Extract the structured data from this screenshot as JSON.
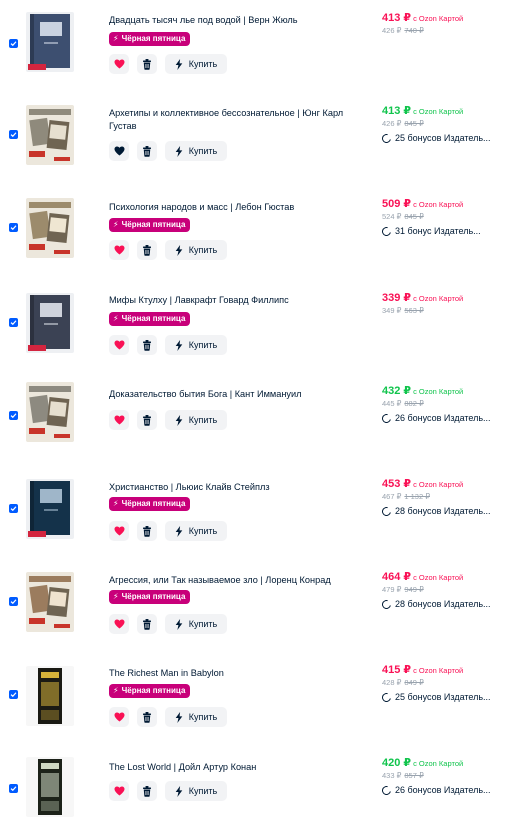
{
  "items": [
    {
      "title": "Двадцать тысяч лье под водой | Верн Жюль",
      "badge": "Чёрная пятница",
      "buy": "Купить",
      "price": "413 ₽",
      "price_color": "pink",
      "card": "с Ozon Картой",
      "base": "426 ₽",
      "old": "740 ₽",
      "bonus": "",
      "fav": true,
      "cover": {
        "bg": "#3d4f70",
        "fg": "#c9d2e0",
        "kind": "navy"
      }
    },
    {
      "title": "Архетипы и коллективное бессознательное | Юнг Карл Густав",
      "badge": "",
      "buy": "Купить",
      "price": "413 ₽",
      "price_color": "green",
      "card": "с Ozon Картой",
      "base": "426 ₽",
      "old": "845 ₽",
      "bonus": "25 бонусов Издатель...",
      "fav": false,
      "cover": {
        "bg": "#8f8a7c",
        "fg": "#e6dfcf",
        "kind": "collage"
      }
    },
    {
      "title": "Психология народов и масс | Лебон Гюстав",
      "badge": "Чёрная пятница",
      "buy": "Купить",
      "price": "509 ₽",
      "price_color": "pink",
      "card": "с Ozon Картой",
      "base": "524 ₽",
      "old": "845 ₽",
      "bonus": "31 бонус Издатель...",
      "fav": true,
      "cover": {
        "bg": "#9c8b6c",
        "fg": "#efe6d2",
        "kind": "collage"
      }
    },
    {
      "title": "Мифы Ктулху | Лавкрафт Говард Филлипс",
      "badge": "Чёрная пятница",
      "buy": "Купить",
      "price": "339 ₽",
      "price_color": "pink",
      "card": "с Ozon Картой",
      "base": "349 ₽",
      "old": "563 ₽",
      "bonus": "",
      "fav": true,
      "cover": {
        "bg": "#3b4254",
        "fg": "#cfd3dc",
        "kind": "navy"
      }
    },
    {
      "title": "Доказательство бытия Бога | Кант Иммануил",
      "badge": "",
      "buy": "Купить",
      "price": "432 ₽",
      "price_color": "green",
      "card": "с Ozon Картой",
      "base": "445 ₽",
      "old": "882 ₽",
      "bonus": "26 бонусов Издатель...",
      "fav": true,
      "cover": {
        "bg": "#8d8a80",
        "fg": "#e6dfcf",
        "kind": "collage"
      }
    },
    {
      "title": "Христианство | Льюис Клайв Стейплз",
      "badge": "Чёрная пятница",
      "buy": "Купить",
      "price": "453 ₽",
      "price_color": "pink",
      "card": "с Ozon Картой",
      "base": "467 ₽",
      "old": "1 132 ₽",
      "bonus": "28 бонусов Издатель...",
      "fav": true,
      "cover": {
        "bg": "#14324a",
        "fg": "#9fb6c9",
        "kind": "navy"
      }
    },
    {
      "title": "Агрессия, или Так называемое зло | Лоренц Конрад",
      "badge": "Чёрная пятница",
      "buy": "Купить",
      "price": "464 ₽",
      "price_color": "pink",
      "card": "с Ozon Картой",
      "base": "479 ₽",
      "old": "949 ₽",
      "bonus": "28 бонусов Издатель...",
      "fav": true,
      "cover": {
        "bg": "#9b7c5e",
        "fg": "#efe3cf",
        "kind": "collage"
      }
    },
    {
      "title": "The Richest Man in Babylon",
      "badge": "Чёрная пятница",
      "buy": "Купить",
      "price": "415 ₽",
      "price_color": "pink",
      "card": "с Ozon Картой",
      "base": "428 ₽",
      "old": "849 ₽",
      "bonus": "25 бонусов Издатель...",
      "fav": true,
      "cover": {
        "bg": "#1a1a14",
        "fg": "#d6b23a",
        "kind": "dark"
      }
    },
    {
      "title": "The Lost World | Дойл Артур Конан",
      "badge": "",
      "buy": "Купить",
      "price": "420 ₽",
      "price_color": "green",
      "card": "с Ozon Картой",
      "base": "433 ₽",
      "old": "857 ₽",
      "bonus": "26 бонусов Издатель...",
      "fav": true,
      "cover": {
        "bg": "#1c2219",
        "fg": "#cfd9c4",
        "kind": "dark"
      }
    }
  ]
}
